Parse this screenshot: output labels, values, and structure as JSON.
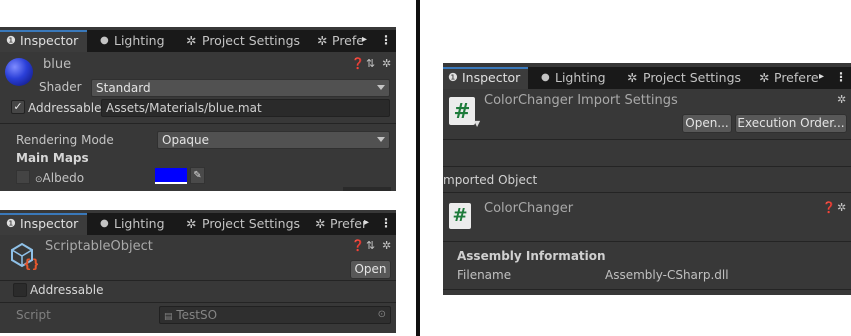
{
  "tabs": {
    "inspector": "Inspector",
    "lighting": "Lighting",
    "project_settings": "Project Settings",
    "preferences_a": "Prefe",
    "preferences_b": "Prefer",
    "preferences_c": "Prefere",
    "overflow_arrow": "▸",
    "menu": "⋮"
  },
  "material_panel": {
    "name": "blue",
    "shader_label": "Shader",
    "shader_value": "Standard",
    "addressable_label": "Addressable",
    "addressable_checked": true,
    "addressable_path": "Assets/Materials/blue.mat",
    "rendering_mode_label": "Rendering Mode",
    "rendering_mode_value": "Opaque",
    "main_maps_label": "Main Maps",
    "albedo_label": "Albedo",
    "albedo_color": "#0000ff"
  },
  "so_panel": {
    "title": "ScriptableObject",
    "open_label": "Open",
    "addressable_label": "Addressable",
    "addressable_checked": false,
    "script_label": "Script",
    "script_value": "TestSO"
  },
  "import_panel": {
    "title": "ColorChanger Import Settings",
    "open_label": "Open...",
    "execution_order_label": "Execution Order...",
    "imported_object_label": "mported Object",
    "object_name": "ColorChanger",
    "assembly_info_label": "Assembly Information",
    "filename_label": "Filename",
    "filename_value": "Assembly-CSharp.dll"
  },
  "icons": {
    "info": "info-icon",
    "bulb": "lightbulb-icon",
    "gear": "gear-icon",
    "help": "help-icon",
    "settings_sliders": "preset-sliders-icon",
    "script": "script-icon",
    "scriptable_object": "scriptable-object-icon",
    "eyedropper": "eyedropper-icon",
    "check": "✓",
    "hash": "#"
  },
  "colors": {
    "panel_bg": "#383838",
    "tab_bar_bg": "#191919",
    "active_tab_accent": "#3a79bb",
    "script_icon_green": "#1e7b3b",
    "sphere_blue": "#2a3fd8"
  }
}
